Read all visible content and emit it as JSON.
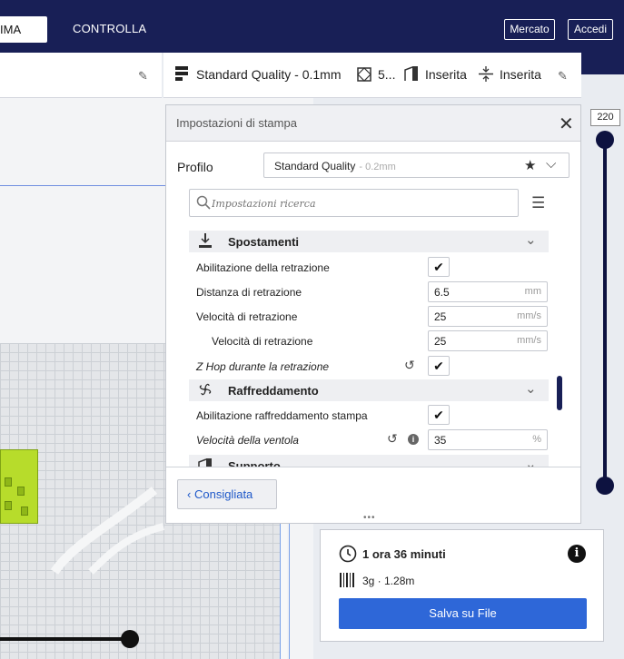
{
  "header": {
    "tab_prepare": "IMA",
    "tab_monitor": "CONTROLLA",
    "market_button": "Mercato",
    "login_button": "Accedi"
  },
  "toolbar": {
    "quality": "Standard Quality - 0.1mm",
    "infill": "5...",
    "support": "Inserita",
    "adhesion": "Inserita"
  },
  "layer_slider": {
    "max_layer": "220"
  },
  "settings_panel": {
    "title": "Impostazioni di stampa",
    "profile_label": "Profilo",
    "profile_name": "Standard Quality",
    "profile_sub": "- 0.2mm",
    "search_placeholder": "Impostazioni ricerca",
    "categories": {
      "travel": "Spostamenti",
      "cooling": "Raffreddamento",
      "support": "Supporto"
    },
    "rows": [
      {
        "label": "Abilitazione della retrazione",
        "checked": "✔"
      },
      {
        "label": "Distanza di retrazione",
        "value": "6.5",
        "unit": "mm"
      },
      {
        "label": "Velocità di retrazione",
        "value": "25",
        "unit": "mm/s"
      },
      {
        "label": "Velocità di retrazione",
        "value": "25",
        "unit": "mm/s"
      },
      {
        "label": "Z Hop durante la retrazione",
        "checked": "✔"
      },
      {
        "label": "Abilitazione raffreddamento stampa",
        "checked": "✔"
      },
      {
        "label": "Velocità della ventola",
        "value": "35",
        "unit": "%"
      }
    ],
    "recommended_button": "Consigliata"
  },
  "summary": {
    "print_time": "1 ora 36 minuti",
    "material": "3g · 1.28m",
    "save_button": "Salva su File"
  }
}
